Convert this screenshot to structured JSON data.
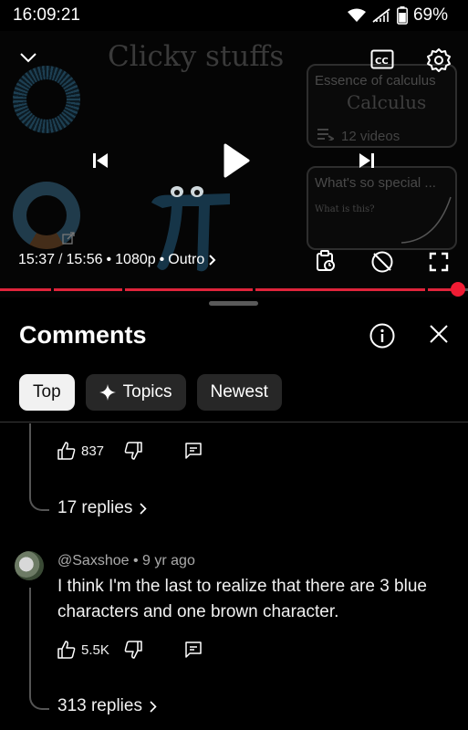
{
  "status": {
    "time": "16:09:21",
    "battery": "69%"
  },
  "player": {
    "video_title_overlay": "Clicky stuffs",
    "current_time": "15:37",
    "duration": "15:56",
    "time_separator": "/",
    "quality": "1080p",
    "chapter": "Outro",
    "bullet": "•",
    "end_cards": [
      {
        "title": "Essence of calculus",
        "subtitle": "Calculus",
        "count": "12 videos"
      },
      {
        "title": "What's so special ...",
        "snippet": "What is this?"
      }
    ],
    "progress_fraction": 0.976
  },
  "comments_panel": {
    "title": "Comments",
    "chips": [
      {
        "label": "Top",
        "active": true
      },
      {
        "label": "Topics",
        "active": false
      },
      {
        "label": "Newest",
        "active": false
      }
    ],
    "threads": [
      {
        "likes": "837",
        "replies": "17 replies"
      },
      {
        "author": "@Saxshoe",
        "age": "9 yr ago",
        "text": "I think I'm the last to realize that there are 3 blue characters and one brown character.",
        "likes": "5.5K",
        "replies": "313 replies"
      }
    ]
  },
  "colors": {
    "accent_red": "#f01c34",
    "chip_bg": "#272727",
    "chip_active_bg": "#f1f1f1",
    "background": "#000000"
  },
  "icons": [
    "chevron-down-icon",
    "closed-captions-icon",
    "settings-gear-icon",
    "previous-icon",
    "play-icon",
    "next-icon",
    "external-link-icon",
    "clip-timer-icon",
    "autoplay-off-icon",
    "fullscreen-icon",
    "info-icon",
    "close-icon",
    "sparkle-icon",
    "thumbs-up-icon",
    "thumbs-down-icon",
    "reply-comment-icon",
    "chevron-right-icon"
  ]
}
